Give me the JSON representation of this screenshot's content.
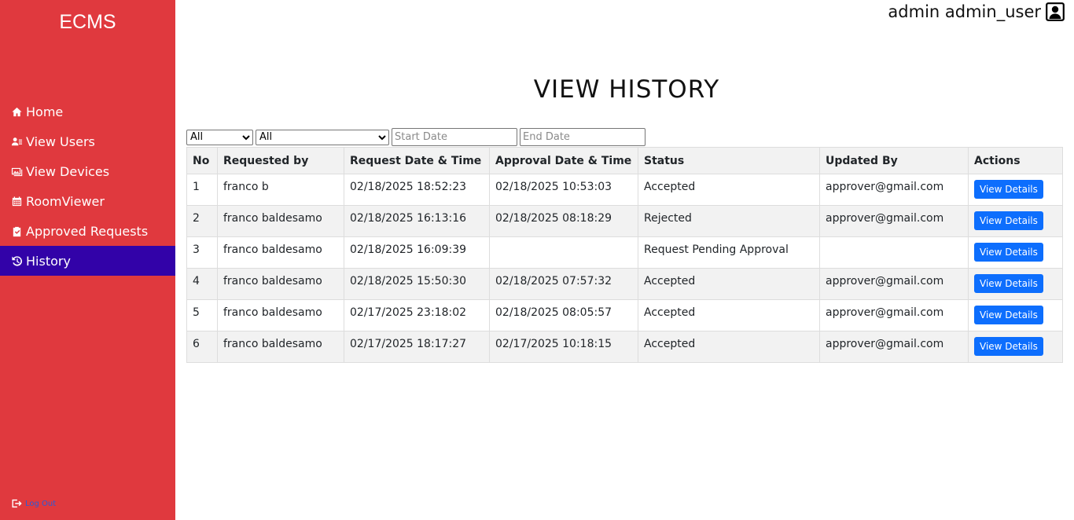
{
  "sidebar": {
    "brand": "ECMS",
    "items": [
      {
        "label": "Home",
        "icon": "home-icon"
      },
      {
        "label": "View Users",
        "icon": "users-icon"
      },
      {
        "label": "View Devices",
        "icon": "devices-icon"
      },
      {
        "label": "RoomViewer",
        "icon": "calendar-icon"
      },
      {
        "label": "Approved Requests",
        "icon": "clipboard-check-icon"
      },
      {
        "label": "History",
        "icon": "history-icon"
      }
    ],
    "active": "History",
    "logout_label": "Log Out"
  },
  "header": {
    "user_name": "admin admin_user"
  },
  "page": {
    "title": "VIEW HISTORY"
  },
  "filters": {
    "select1_value": "All",
    "select2_value": "All",
    "start_placeholder": "Start Date",
    "end_placeholder": "End Date"
  },
  "table": {
    "columns": [
      "No",
      "Requested by",
      "Request Date & Time",
      "Approval Date & Time",
      "Status",
      "Updated By",
      "Actions"
    ],
    "action_label": "View Details",
    "rows": [
      {
        "no": "1",
        "requested_by": "franco b",
        "request_dt": "02/18/2025 18:52:23",
        "approval_dt": "02/18/2025 10:53:03",
        "status": "Accepted",
        "updated_by": "approver@gmail.com"
      },
      {
        "no": "2",
        "requested_by": "franco baldesamo",
        "request_dt": "02/18/2025 16:13:16",
        "approval_dt": "02/18/2025 08:18:29",
        "status": "Rejected",
        "updated_by": "approver@gmail.com"
      },
      {
        "no": "3",
        "requested_by": "franco baldesamo",
        "request_dt": "02/18/2025 16:09:39",
        "approval_dt": "",
        "status": "Request Pending Approval",
        "updated_by": ""
      },
      {
        "no": "4",
        "requested_by": "franco baldesamo",
        "request_dt": "02/18/2025 15:50:30",
        "approval_dt": "02/18/2025 07:57:32",
        "status": "Accepted",
        "updated_by": "approver@gmail.com"
      },
      {
        "no": "5",
        "requested_by": "franco baldesamo",
        "request_dt": "02/17/2025 23:18:02",
        "approval_dt": "02/18/2025 08:05:57",
        "status": "Accepted",
        "updated_by": "approver@gmail.com"
      },
      {
        "no": "6",
        "requested_by": "franco baldesamo",
        "request_dt": "02/17/2025 18:17:27",
        "approval_dt": "02/17/2025 10:18:15",
        "status": "Accepted",
        "updated_by": "approver@gmail.com"
      }
    ]
  },
  "colors": {
    "sidebar_bg": "#e0393e",
    "active_item_bg": "#3202a8",
    "button_bg": "#0d6efd"
  }
}
